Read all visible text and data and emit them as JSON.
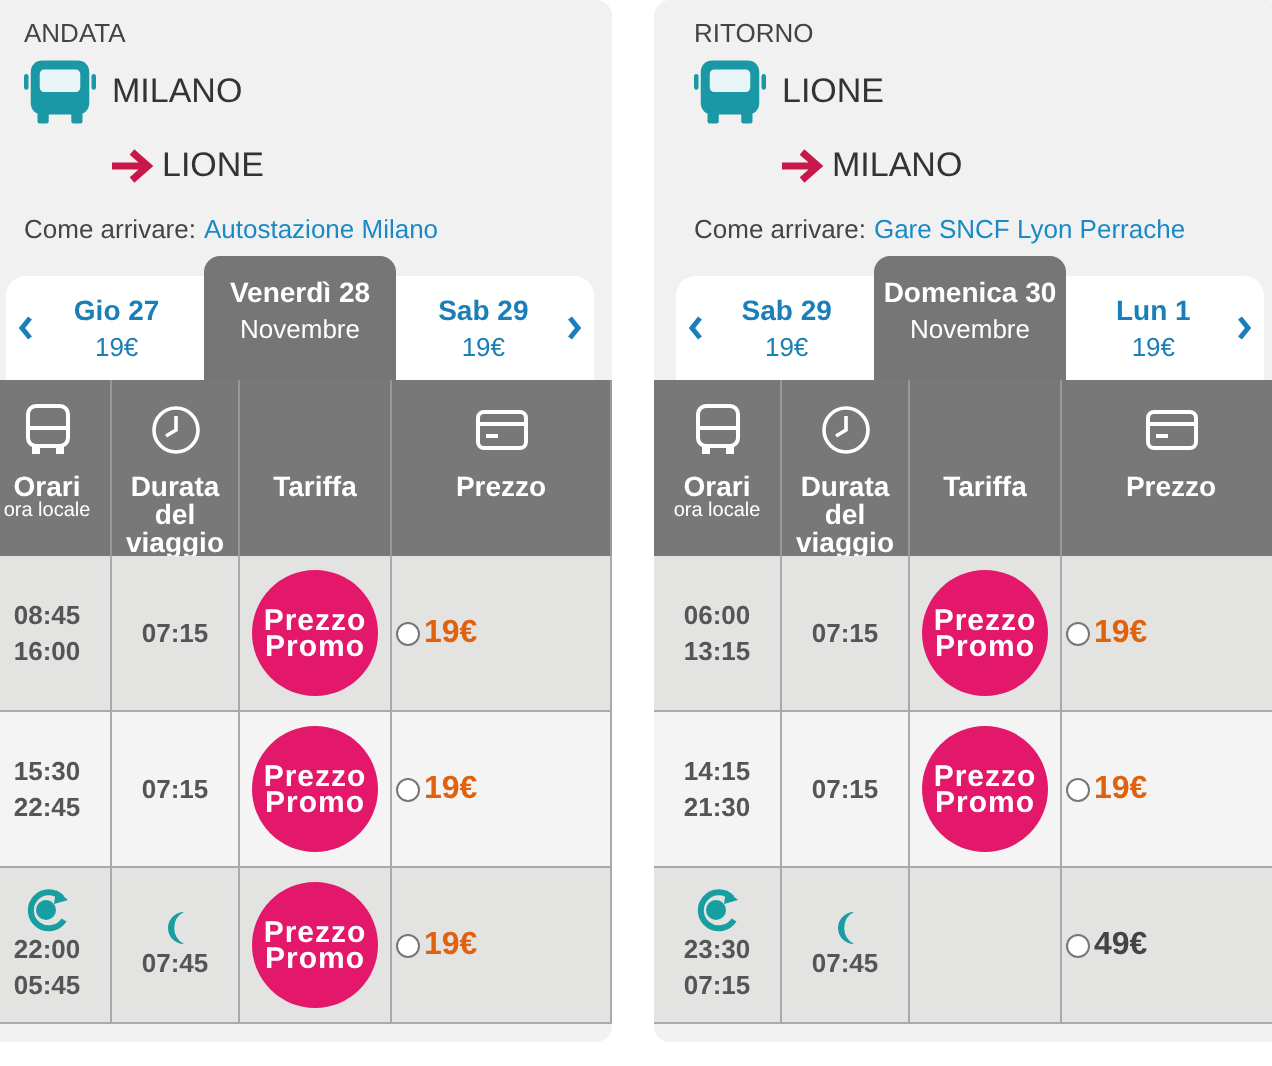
{
  "panels": [
    {
      "direction": "ANDATA",
      "from": "MILANO",
      "to": "LIONE",
      "directions_label": "Come arrivare:",
      "directions_link": "Autostazione Milano",
      "dates": [
        {
          "day": "Gio 27",
          "sub": "19€",
          "selected": false
        },
        {
          "day": "Venerdì 28",
          "sub": "Novembre",
          "selected": true
        },
        {
          "day": "Sab 29",
          "sub": "19€",
          "selected": false
        }
      ],
      "columns": [
        {
          "kind": "bus",
          "label": "Orari",
          "sub": "ora locale"
        },
        {
          "kind": "clock",
          "label": "Durata del viaggio"
        },
        {
          "kind": "none",
          "label": "Tariffa"
        },
        {
          "kind": "card",
          "label": "Prezzo"
        }
      ],
      "rows": [
        {
          "depart": "08:45",
          "arrive": "16:00",
          "night": false,
          "duration": "07:15",
          "promo": true,
          "promo_label": "Prezzo Promo",
          "price": "19€",
          "selected": false
        },
        {
          "depart": "15:30",
          "arrive": "22:45",
          "night": false,
          "duration": "07:15",
          "promo": true,
          "promo_label": "Prezzo Promo",
          "price": "19€",
          "selected": false
        },
        {
          "depart": "22:00",
          "arrive": "05:45",
          "night": true,
          "duration": "07:45",
          "promo": true,
          "promo_label": "Prezzo Promo",
          "price": "19€",
          "selected": false
        }
      ]
    },
    {
      "direction": "RITORNO",
      "from": "LIONE",
      "to": "MILANO",
      "directions_label": "Come arrivare:",
      "directions_link": "Gare SNCF Lyon Perrache",
      "dates": [
        {
          "day": "Sab 29",
          "sub": "19€",
          "selected": false
        },
        {
          "day": "Domenica 30",
          "sub": "Novembre",
          "selected": true
        },
        {
          "day": "Lun 1",
          "sub": "19€",
          "selected": false
        }
      ],
      "columns": [
        {
          "kind": "bus",
          "label": "Orari",
          "sub": "ora locale"
        },
        {
          "kind": "clock",
          "label": "Durata del viaggio"
        },
        {
          "kind": "none",
          "label": "Tariffa"
        },
        {
          "kind": "card",
          "label": "Prezzo"
        }
      ],
      "rows": [
        {
          "depart": "06:00",
          "arrive": "13:15",
          "night": false,
          "duration": "07:15",
          "promo": true,
          "promo_label": "Prezzo Promo",
          "price": "19€",
          "selected": false
        },
        {
          "depart": "14:15",
          "arrive": "21:30",
          "night": false,
          "duration": "07:15",
          "promo": true,
          "promo_label": "Prezzo Promo",
          "price": "19€",
          "selected": false
        },
        {
          "depart": "23:30",
          "arrive": "07:15",
          "night": true,
          "duration": "07:45",
          "promo": false,
          "price": "49€",
          "selected": false
        }
      ]
    }
  ]
}
